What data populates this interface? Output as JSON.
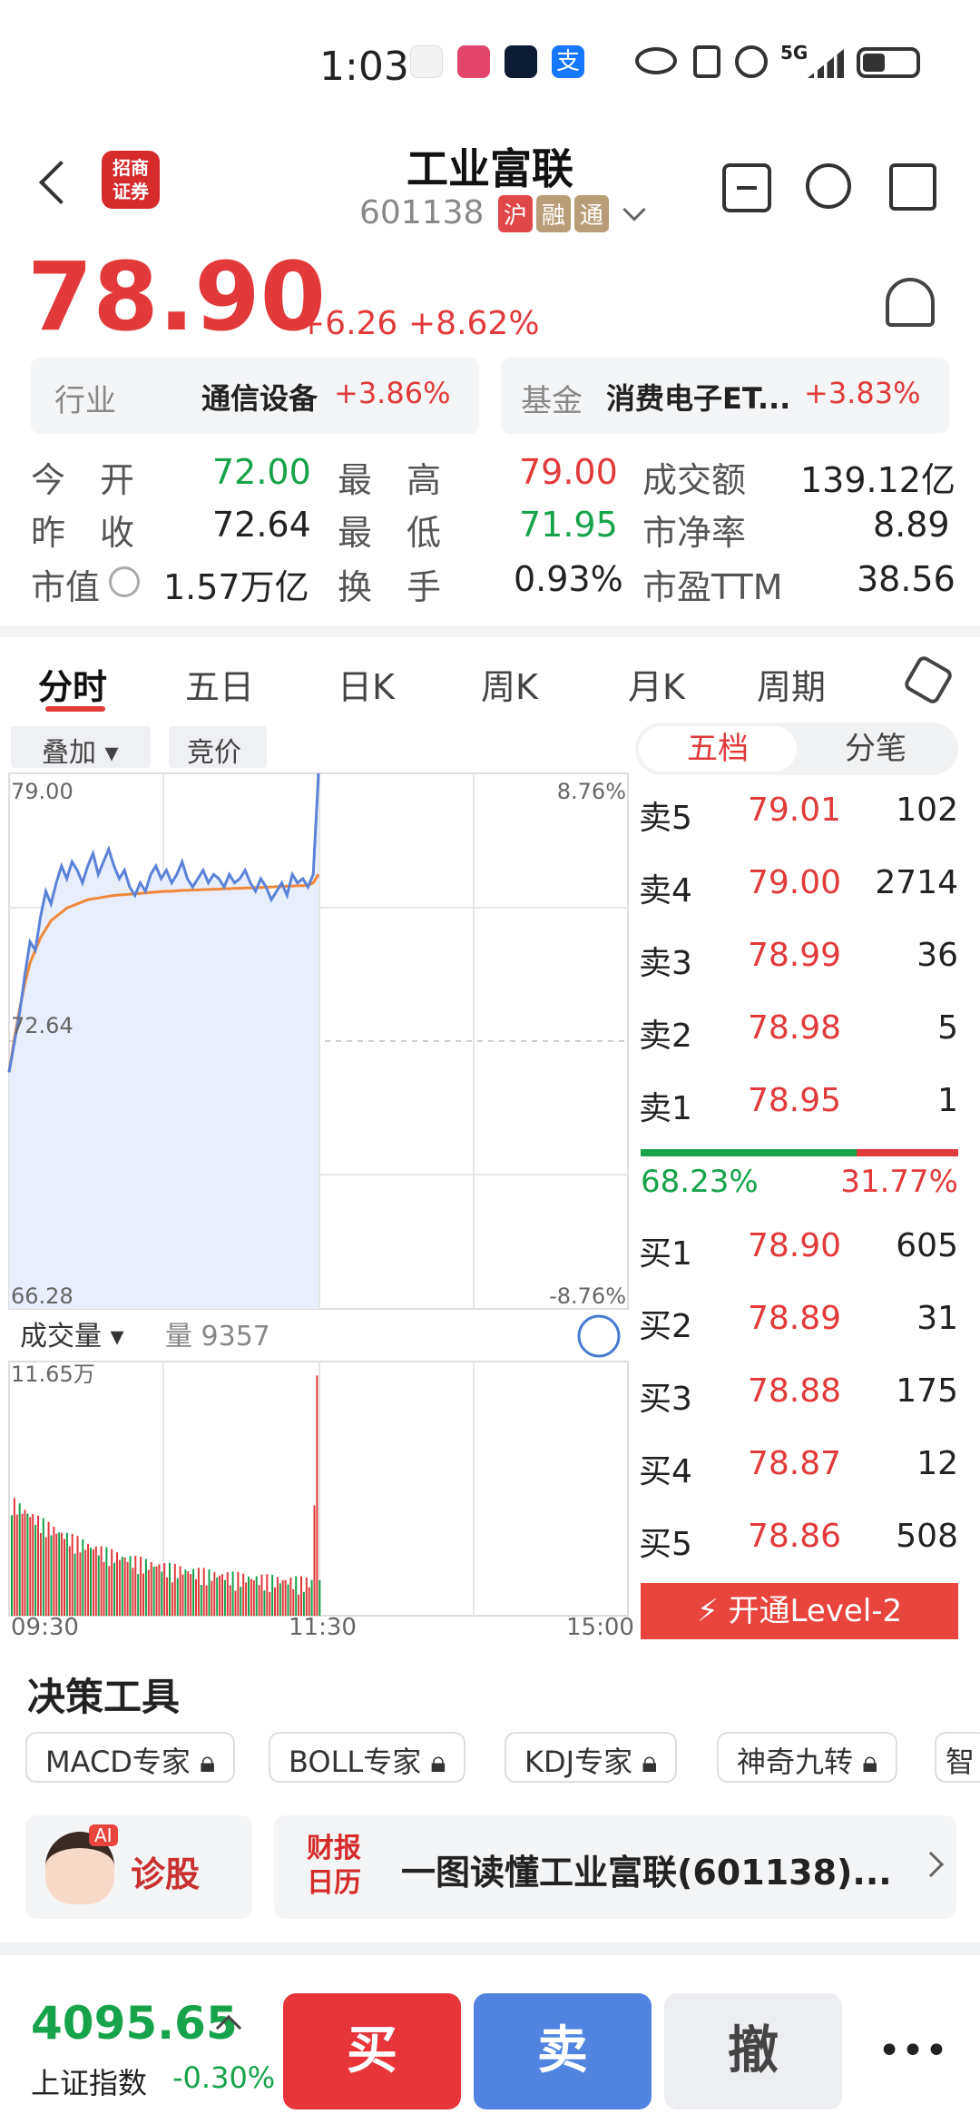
{
  "status_bar": {
    "time": "1:03",
    "network": "5G"
  },
  "header": {
    "title": "工业富联",
    "code": "601138",
    "chips": [
      "沪",
      "融",
      "通"
    ],
    "broker_logo": "招商证券"
  },
  "quote": {
    "price": "78.90",
    "change": "+6.26",
    "change_pct": "+8.62%"
  },
  "industry": {
    "label": "行业",
    "name": "通信设备",
    "pct": "+3.86%"
  },
  "fund": {
    "label": "基金",
    "name": "消费电子ET...",
    "pct": "+3.83%"
  },
  "stats": {
    "open_label": "今　开",
    "open": "72.00",
    "high_label": "最　高",
    "high": "79.00",
    "turnover_label": "成交额",
    "turnover": "139.12亿",
    "prev_label": "昨　收",
    "prev": "72.64",
    "low_label": "最　低",
    "low": "71.95",
    "pb_label": "市净率",
    "pb": "8.89",
    "mcap_label": "市值",
    "mcap": "1.57万亿",
    "turnrate_label": "换　手",
    "turnrate": "0.93%",
    "pe_label": "市盈TTM",
    "pe": "38.56"
  },
  "tabs": [
    "分时",
    "五日",
    "日K",
    "周K",
    "月K",
    "周期"
  ],
  "chart_controls": {
    "overlay": "叠加",
    "auction": "竞价"
  },
  "chart_data": {
    "type": "line",
    "x_start": "09:30",
    "x_mid": "11:30",
    "x_end": "15:00",
    "y_top": "79.00",
    "y_mid": "72.64",
    "y_bottom": "66.28",
    "pct_top": "8.76%",
    "pct_bottom": "-8.76%",
    "price": [
      71.9,
      72.6,
      73.3,
      74.2,
      75.0,
      74.8,
      75.6,
      76.2,
      75.9,
      76.4,
      76.8,
      76.5,
      76.9,
      76.7,
      76.4,
      76.8,
      77.1,
      76.6,
      76.9,
      77.2,
      76.8,
      76.5,
      76.7,
      76.3,
      76.1,
      76.4,
      76.2,
      76.6,
      76.8,
      76.5,
      76.7,
      76.4,
      76.6,
      76.9,
      76.5,
      76.3,
      76.5,
      76.7,
      76.4,
      76.6,
      76.5,
      76.3,
      76.6,
      76.4,
      76.5,
      76.7,
      76.4,
      76.2,
      76.5,
      76.3,
      76.0,
      76.2,
      76.4,
      76.1,
      76.6,
      76.4,
      76.5,
      76.3,
      76.6,
      79.0
    ],
    "avg": [
      71.9,
      72.7,
      73.4,
      74.0,
      74.5,
      74.8,
      75.1,
      75.3,
      75.5,
      75.6,
      75.7,
      75.8,
      75.85,
      75.9,
      75.95,
      76.0,
      76.02,
      76.04,
      76.06,
      76.08,
      76.1,
      76.11,
      76.12,
      76.13,
      76.14,
      76.15,
      76.16,
      76.17,
      76.18,
      76.19,
      76.2,
      76.2,
      76.21,
      76.22,
      76.22,
      76.23,
      76.23,
      76.24,
      76.24,
      76.25,
      76.25,
      76.26,
      76.26,
      76.27,
      76.27,
      76.28,
      76.28,
      76.29,
      76.29,
      76.3,
      76.3,
      76.31,
      76.31,
      76.32,
      76.32,
      76.33,
      76.33,
      76.34,
      76.4,
      76.6
    ],
    "volume_label": "成交量",
    "volume_value_label": "量 9357",
    "volume_max": "11.65万"
  },
  "orderbook": {
    "tabs": [
      "五档",
      "分笔"
    ],
    "asks": [
      {
        "label": "卖5",
        "price": "79.01",
        "qty": "102"
      },
      {
        "label": "卖4",
        "price": "79.00",
        "qty": "2714"
      },
      {
        "label": "卖3",
        "price": "78.99",
        "qty": "36"
      },
      {
        "label": "卖2",
        "price": "78.98",
        "qty": "5"
      },
      {
        "label": "卖1",
        "price": "78.95",
        "qty": "1"
      }
    ],
    "buy_ratio": "68.23%",
    "sell_ratio": "31.77%",
    "bids": [
      {
        "label": "买1",
        "price": "78.90",
        "qty": "605"
      },
      {
        "label": "买2",
        "price": "78.89",
        "qty": "31"
      },
      {
        "label": "买3",
        "price": "78.88",
        "qty": "175"
      },
      {
        "label": "买4",
        "price": "78.87",
        "qty": "12"
      },
      {
        "label": "买5",
        "price": "78.86",
        "qty": "508"
      }
    ],
    "level2_button": "开通Level-2"
  },
  "tools": {
    "title": "决策工具",
    "items": [
      "MACD专家",
      "BOLL专家",
      "KDJ专家",
      "神奇九转",
      "智"
    ]
  },
  "promo": {
    "ai_label": "诊股",
    "ai_badge": "AI",
    "report_badge": "财报日历",
    "report_text": "一图读懂工业富联(601138)..."
  },
  "bottom": {
    "index_value": "4095.65",
    "index_name": "上证指数",
    "index_pct": "-0.30%",
    "buy": "买",
    "sell": "卖",
    "cancel": "撤",
    "more": "•••"
  }
}
